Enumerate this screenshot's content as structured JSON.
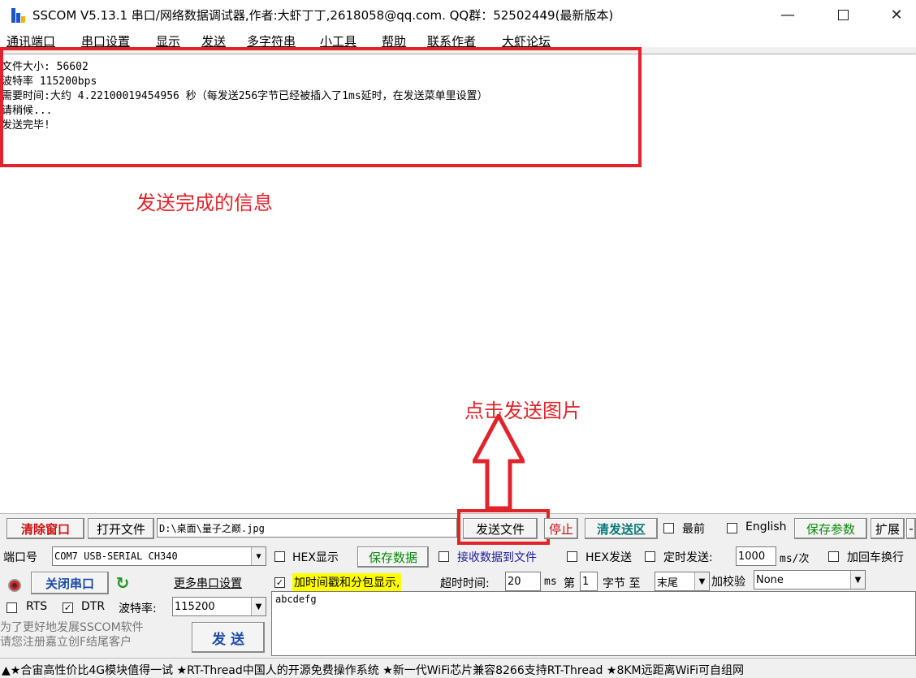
{
  "window": {
    "title": "SSCOM V5.13.1 串口/网络数据调试器,作者:大虾丁丁,2618058@qq.com. QQ群：52502449(最新版本)",
    "minimize": "—",
    "close": "✕"
  },
  "menu": [
    "通讯端口",
    "串口设置",
    "显示",
    "发送",
    "多字符串",
    "小工具",
    "帮助",
    "联系作者",
    "大虾论坛"
  ],
  "output": {
    "lines": [
      "文件大小: 56602",
      "波特率 115200bps",
      "需要时间:大约 4.22100019454956 秒（每发送256字节已经被插入了1ms延时，在发送菜单里设置）",
      "请稍候...",
      "发送完毕!"
    ]
  },
  "annotations": {
    "info_text": "发送完成的信息",
    "send_text": "点击发送图片",
    "color": "#e0242a"
  },
  "toolbar": {
    "clear_window": "清除窗口",
    "open_file": "打开文件",
    "file_path": "D:\\桌面\\量子之巅.jpg",
    "send_file": "发送文件",
    "stop": "停止",
    "clear_send": "清发送区",
    "topmost": "最前",
    "english": "English",
    "save_params": "保存参数",
    "expand": "扩展",
    "minus": "-"
  },
  "port": {
    "label": "端口号",
    "value": "COM7 USB-SERIAL CH340",
    "hex_display": "HEX显示",
    "save_data": "保存数据",
    "recv_to_file": "接收数据到文件",
    "hex_send": "HEX发送",
    "timed_send": "定时发送:",
    "interval": "1000",
    "interval_unit": "ms/次",
    "add_crlf": "加回车换行"
  },
  "row3": {
    "close_port": "关闭串口",
    "more_settings": "更多串口设置",
    "timestamp": "加时间戳和分包显示,",
    "timeout_label": "超时时间:",
    "timeout": "20",
    "timeout_unit": "ms",
    "nth": "第",
    "byte_index": "1",
    "byte_to": "字节 至",
    "tail": "末尾",
    "checksum_label": "加校验",
    "checksum": "None"
  },
  "row4": {
    "rts": "RTS",
    "dtr": "DTR",
    "baud_label": "波特率:",
    "baud": "115200",
    "send_content": "abcdefg"
  },
  "promo": {
    "line1": "为了更好地发展SSCOM软件",
    "line2": "请您注册嘉立创F结尾客户",
    "send": "发 送"
  },
  "status": {
    "text": "▲★合宙高性价比4G模块值得一试 ★RT-Thread中国人的开源免费操作系统 ★新一代WiFi芯片兼容8266支持RT-Thread ★8KM远距离WiFi可自组网"
  }
}
